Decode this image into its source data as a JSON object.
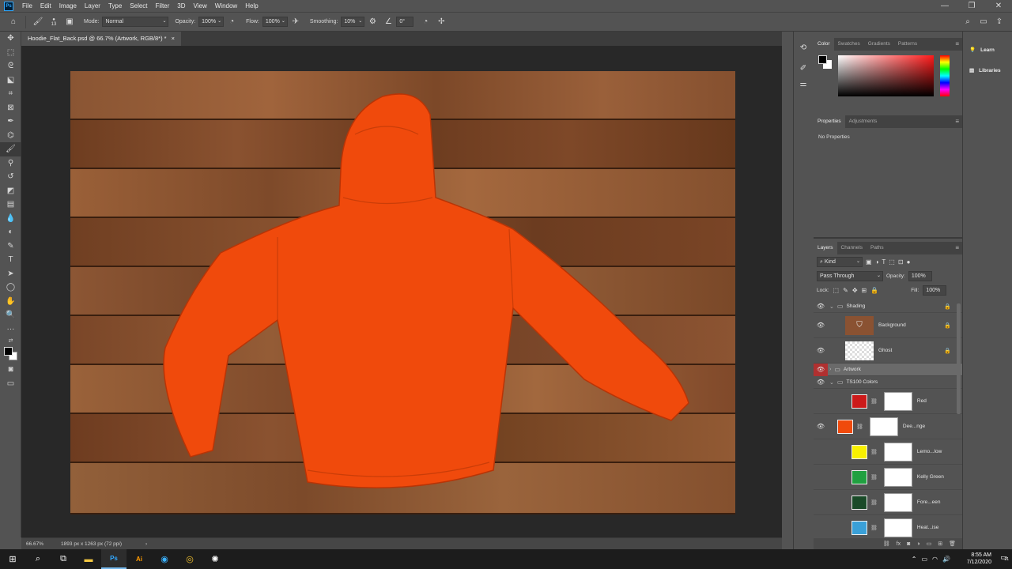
{
  "menubar": {
    "logo": "Ps",
    "items": [
      "File",
      "Edit",
      "Image",
      "Layer",
      "Type",
      "Select",
      "Filter",
      "3D",
      "View",
      "Window",
      "Help"
    ],
    "window_controls": [
      "—",
      "❐",
      "✕"
    ]
  },
  "options": {
    "brush_size": "13",
    "mode_label": "Mode:",
    "mode_value": "Normal",
    "opacity_label": "Opacity:",
    "opacity_value": "100%",
    "flow_label": "Flow:",
    "flow_value": "100%",
    "smoothing_label": "Smoothing:",
    "smoothing_value": "10%",
    "angle_value": "0°"
  },
  "document": {
    "tab_title": "Hoodie_Flat_Back.psd @ 66.7% (Artwork, RGB/8*) *",
    "tab_close": "×",
    "hoodie_color": "#f04a0c",
    "wood_color": "#7a4626"
  },
  "status": {
    "zoom": "66.67%",
    "doc_info": "1893 px x 1263 px (72 ppi)",
    "arrow": "›"
  },
  "color_panel": {
    "tabs": [
      "Color",
      "Swatches",
      "Gradients",
      "Patterns"
    ],
    "hue_color": "#ff1a1a"
  },
  "properties_panel": {
    "tabs": [
      "Properties",
      "Adjustments"
    ],
    "empty_text": "No Properties"
  },
  "layers_panel": {
    "tabs": [
      "Layers",
      "Channels",
      "Paths"
    ],
    "filter_kind": "Kind",
    "blend_mode": "Pass Through",
    "opacity_label": "Opacity:",
    "opacity_value": "100%",
    "lock_label": "Lock:",
    "fill_label": "Fill:",
    "fill_value": "100%",
    "groups": {
      "shading": "Shading",
      "artwork": "Artwork",
      "ts100": "TS100 Colors"
    },
    "layers": {
      "background": "Background",
      "ghost": "Ghost"
    },
    "colors": [
      {
        "name": "Red",
        "color": "#cc1a1a"
      },
      {
        "name": "Dee...nge",
        "color": "#f04a0c"
      },
      {
        "name": "Lemo...low",
        "color": "#f8f000"
      },
      {
        "name": "Kelly Green",
        "color": "#20a040"
      },
      {
        "name": "Fore...een",
        "color": "#1a4a28"
      },
      {
        "name": "Heat...ise",
        "color": "#3aa0d8"
      }
    ]
  },
  "right_dock": {
    "learn": "Learn",
    "libraries": "Libraries"
  },
  "taskbar": {
    "time": "8:55 AM",
    "date": "7/12/2020",
    "notification_count": "21"
  }
}
